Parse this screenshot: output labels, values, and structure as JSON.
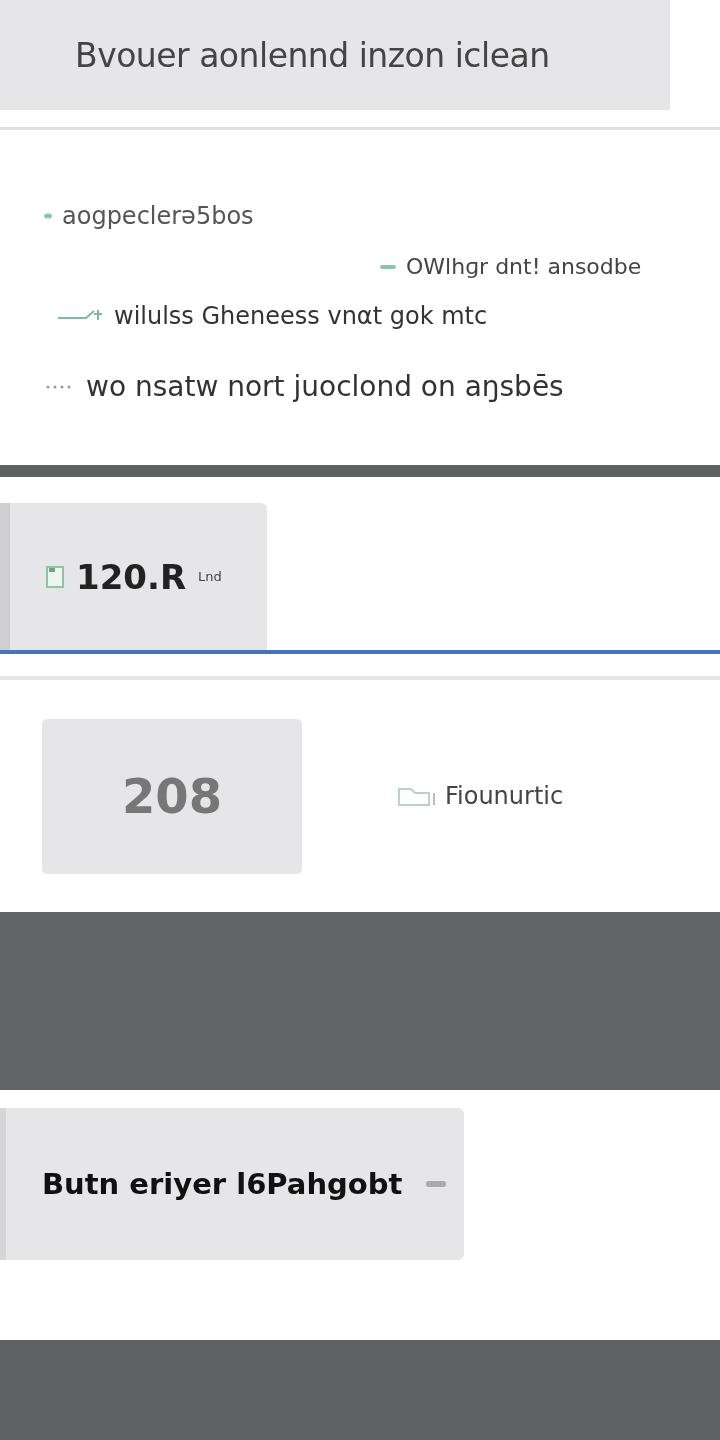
{
  "header": {
    "title": "Bvouer aonlennd inzon iclean"
  },
  "lines": [
    {
      "kind": "dot",
      "text": "aogpeclerə5bos"
    },
    {
      "kind": "dash",
      "text": "OWlhɡr dnt! ansodbe"
    },
    {
      "kind": "arrow",
      "text": "wilulss Gheneess vnαt gok mtc"
    },
    {
      "kind": "dots",
      "text": "wo nsatw nort juoclond on aŋsbēs"
    }
  ],
  "tab_card": {
    "value": "120.R",
    "unit": "Lnd"
  },
  "stat": {
    "value": "208",
    "label": "Fiounurtic"
  },
  "button": {
    "label": "Butn eriyer l6Pahgobt"
  }
}
